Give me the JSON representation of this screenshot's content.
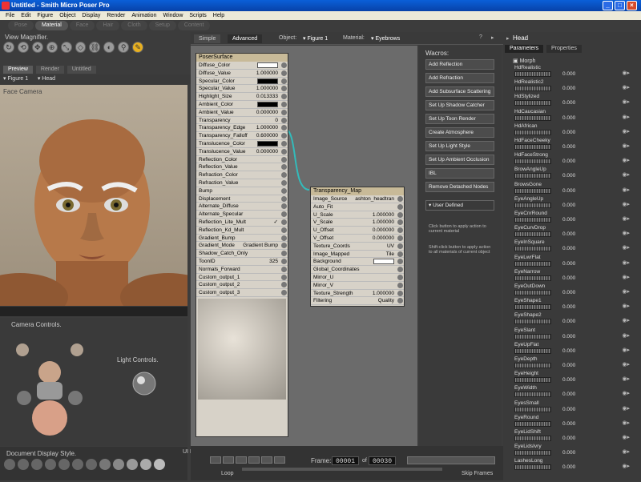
{
  "window": {
    "title": "Untitled - Smith Micro Poser Pro",
    "min": "_",
    "max": "□",
    "close": "×"
  },
  "menu": [
    "File",
    "Edit",
    "Figure",
    "Object",
    "Display",
    "Render",
    "Animation",
    "Window",
    "Scripts",
    "Help"
  ],
  "rooms": [
    "Pose",
    "Material",
    "Face",
    "Hair",
    "Cloth",
    "Setup",
    "Content"
  ],
  "active_room": "Material",
  "view_magnifier": "View Magnifier.",
  "preview": {
    "tabs": [
      "Preview",
      "Render",
      "Untitled"
    ],
    "figure": "Figure 1",
    "part": "Head",
    "camera": "Face Camera"
  },
  "camera_controls": "Camera Controls.",
  "light_controls": "Light Controls.",
  "document_display_style": "Document Display Style.",
  "ui_dots": "UI Dots.",
  "material": {
    "tabs": [
      "Simple",
      "Advanced"
    ],
    "object_label": "Object:",
    "object_value": "Figure 1",
    "material_label": "Material:",
    "material_value": "Eyebrows"
  },
  "poser_surface": {
    "title": "PoserSurface",
    "rows": [
      {
        "name": "Diffuse_Color",
        "value": "",
        "swatch": "#ffffff"
      },
      {
        "name": "Diffuse_Value",
        "value": "1.000000"
      },
      {
        "name": "Specular_Color",
        "value": "",
        "swatch": "#000000"
      },
      {
        "name": "Specular_Value",
        "value": "1.000000"
      },
      {
        "name": "Highlight_Size",
        "value": "0.013333"
      },
      {
        "name": "Ambient_Color",
        "value": "",
        "swatch": "#000000"
      },
      {
        "name": "Ambient_Value",
        "value": "0.000000"
      },
      {
        "name": "Transparency",
        "value": "0"
      },
      {
        "name": "Transparency_Edge",
        "value": "1.000000"
      },
      {
        "name": "Transparency_Falloff",
        "value": "0.600000"
      },
      {
        "name": "Translucence_Color",
        "value": "",
        "swatch": "#000000"
      },
      {
        "name": "Translucence_Value",
        "value": "0.000000"
      },
      {
        "name": "Reflection_Color",
        "value": ""
      },
      {
        "name": "Reflection_Value",
        "value": ""
      },
      {
        "name": "Refraction_Color",
        "value": ""
      },
      {
        "name": "Refraction_Value",
        "value": ""
      },
      {
        "name": "Bump",
        "value": ""
      },
      {
        "name": "Displacement",
        "value": ""
      },
      {
        "name": "Alternate_Diffuse",
        "value": ""
      },
      {
        "name": "Alternate_Specular",
        "value": ""
      },
      {
        "name": "Reflection_Lite_Mult",
        "value": "✓"
      },
      {
        "name": "Reflection_Kd_Mult",
        "value": ""
      },
      {
        "name": "Gradient_Bump",
        "value": ""
      },
      {
        "name": "Gradient_Mode",
        "value": "Gradient Bump"
      },
      {
        "name": "Shadow_Catch_Only",
        "value": ""
      },
      {
        "name": "ToonID",
        "value": "325"
      },
      {
        "name": "Normals_Forward",
        "value": ""
      },
      {
        "name": "Custom_output_1",
        "value": ""
      },
      {
        "name": "Custom_output_2",
        "value": ""
      },
      {
        "name": "Custom_output_3",
        "value": ""
      }
    ]
  },
  "transparency_map": {
    "title": "Transparency_Map",
    "rows": [
      {
        "name": "Image_Source",
        "value": "ashton_headtran"
      },
      {
        "name": "Auto_Fit",
        "value": ""
      },
      {
        "name": "U_Scale",
        "value": "1.000000"
      },
      {
        "name": "V_Scale",
        "value": "1.000000"
      },
      {
        "name": "U_Offset",
        "value": "0.000000"
      },
      {
        "name": "V_Offset",
        "value": "0.000000"
      },
      {
        "name": "Texture_Coords",
        "value": "UV"
      },
      {
        "name": "Image_Mapped",
        "value": "Tile"
      },
      {
        "name": "Background",
        "value": "",
        "swatch": "#ffffff"
      },
      {
        "name": "Global_Coordinates",
        "value": ""
      },
      {
        "name": "Mirror_U",
        "value": ""
      },
      {
        "name": "Mirror_V",
        "value": ""
      },
      {
        "name": "Texture_Strength",
        "value": "1.000000"
      },
      {
        "name": "Filtering",
        "value": "Quality"
      }
    ]
  },
  "wacros": {
    "title": "Wacros:",
    "buttons": [
      "Add Reflection",
      "Add Refraction",
      "Add Subsurface Scattering",
      "Set Up Shadow Catcher",
      "Set Up Toon Render",
      "Create Atmosphere",
      "Set Up Light Style",
      "Set Up Ambient Occlusion",
      "IBL",
      "Remove Detached Nodes"
    ],
    "user_defined": "User Defined",
    "help1": "Click button to apply action to current material",
    "help2": "Shift-click button to apply action to all materials of current object"
  },
  "timeline": {
    "frame_label": "Frame:",
    "current": "00001",
    "of": "of",
    "total": "00030",
    "loop": "Loop",
    "skip": "Skip Frames"
  },
  "params": {
    "title": "Head",
    "tabs": [
      "Parameters",
      "Properties"
    ],
    "group": "Morph",
    "morphs": [
      {
        "name": "HdRealistic",
        "value": "0.000"
      },
      {
        "name": "HdRealistic2",
        "value": "0.000"
      },
      {
        "name": "HdStylized",
        "value": "0.000"
      },
      {
        "name": "HdCaucasian",
        "value": "0.000"
      },
      {
        "name": "HdAfrican",
        "value": "0.000"
      },
      {
        "name": "HdFaceCheeky",
        "value": "0.000"
      },
      {
        "name": "HdFaceStrong",
        "value": "0.000"
      },
      {
        "name": "BrowAngleUp",
        "value": "0.000"
      },
      {
        "name": "BrowsGone",
        "value": "0.000"
      },
      {
        "name": "EyeAngleUp",
        "value": "0.000"
      },
      {
        "name": "EyeCnrRound",
        "value": "0.000"
      },
      {
        "name": "EyeCurvDrop",
        "value": "0.000"
      },
      {
        "name": "EyeInSquare",
        "value": "0.000"
      },
      {
        "name": "EyeLwrFlat",
        "value": "0.000"
      },
      {
        "name": "EyeNarrow",
        "value": "0.000"
      },
      {
        "name": "EyeOutDown",
        "value": "0.000"
      },
      {
        "name": "EyeShape1",
        "value": "0.000"
      },
      {
        "name": "EyeShape2",
        "value": "0.000"
      },
      {
        "name": "EyeSlant",
        "value": "0.000"
      },
      {
        "name": "EyeUpFlat",
        "value": "0.000"
      },
      {
        "name": "EyeDepth",
        "value": "0.000"
      },
      {
        "name": "EyeHeight",
        "value": "0.000"
      },
      {
        "name": "EyeWidth",
        "value": "0.000"
      },
      {
        "name": "EyesSmall",
        "value": "0.000"
      },
      {
        "name": "EyeRound",
        "value": "0.000"
      },
      {
        "name": "EyeLidShift",
        "value": "0.000"
      },
      {
        "name": "EyeLidsIvry",
        "value": "0.000"
      },
      {
        "name": "LashesLong",
        "value": "0.000"
      }
    ]
  }
}
